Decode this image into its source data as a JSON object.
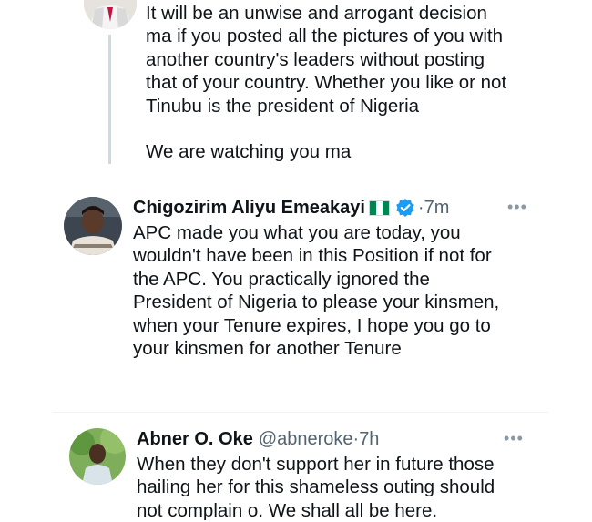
{
  "tweets": [
    {
      "text": "It will be an unwise and arrogant decision\nma if you posted all the pictures of you with\nanother country's leaders without posting\nthat of your country. Whether you like or not\nTinubu is the president of Nigeria\n\nWe are watching you ma"
    },
    {
      "name": "Chigozirim Aliyu Emeakayi",
      "flag_icon": "nigeria-flag-icon",
      "verified_icon": "verified-badge-icon",
      "time": "7m",
      "text": "APC made you what you are today, you\nwouldn't have been in this Position if not for\nthe APC. You practically ignored the\nPresident of Nigeria to please your kinsmen,\nwhen your Tenure expires, I hope you go to\nyour kinsmen for another Tenure"
    },
    {
      "name": "Abner O. Oke",
      "handle": "@abneroke",
      "time": "7h",
      "text": "When they don't support her in future those\nhailing her for this shameless outing should\nnot complain o. We shall all be here."
    }
  ],
  "separator": "·",
  "more_label": "•••",
  "colors": {
    "verified": "#1d9bf0",
    "flag_green": "#008751",
    "secondary_text": "#536471",
    "thread_line": "#cfd9de"
  }
}
